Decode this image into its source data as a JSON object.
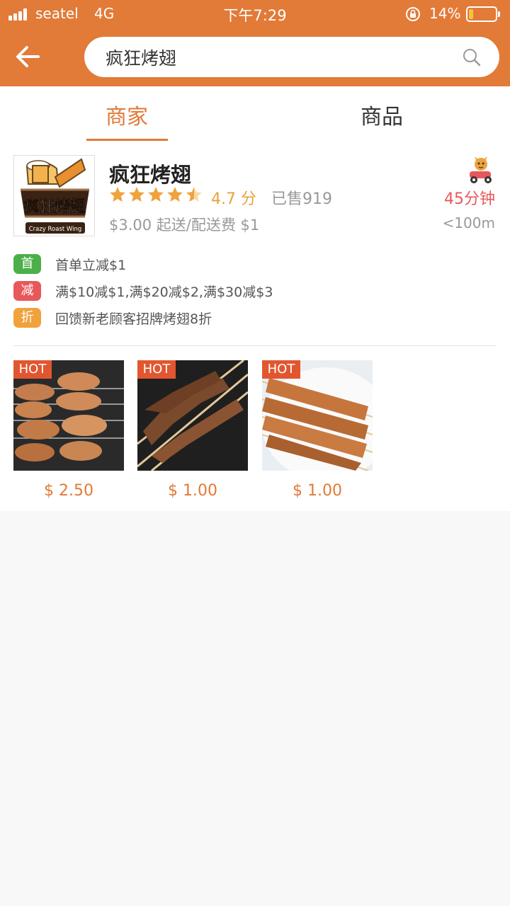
{
  "status_bar": {
    "carrier": "seatel",
    "network": "4G",
    "time": "下午7:29",
    "battery_percent": "14%",
    "battery_level": 0.14
  },
  "search": {
    "query": "疯狂烤翅",
    "icon": "search-icon"
  },
  "tabs": [
    {
      "label": "商家",
      "active": true
    },
    {
      "label": "商品",
      "active": false
    }
  ],
  "shop": {
    "name": "疯狂烤翅",
    "logo_text": "疯狂烤翅",
    "logo_subtext": "Crazy Roast Wing",
    "rating_stars": 4.7,
    "rating_text": "4.7 分",
    "sold_text": "已售919",
    "min_order_text": "$3.00 起送/配送费 $1",
    "delivery_time": "45分钟",
    "distance": "<100m"
  },
  "promotions": [
    {
      "badge": "首",
      "color": "#4caf4a",
      "text": "首单立减$1"
    },
    {
      "badge": "减",
      "color": "#e8585b",
      "text": "满$10减$1,满$20减$2,满$30减$3"
    },
    {
      "badge": "折",
      "color": "#f0a23c",
      "text": "回馈新老顾客招牌烤翅8折"
    }
  ],
  "products": [
    {
      "tag": "HOT",
      "price": "$ 2.50",
      "image": "grilled-wings"
    },
    {
      "tag": "HOT",
      "price": "$ 1.00",
      "image": "beef-skewers"
    },
    {
      "tag": "HOT",
      "price": "$ 1.00",
      "image": "chicken-skewers"
    }
  ],
  "colors": {
    "accent": "#e27a38",
    "star": "#f0a23c",
    "delivery": "#e8585b",
    "hot_tag": "#e2562f"
  }
}
